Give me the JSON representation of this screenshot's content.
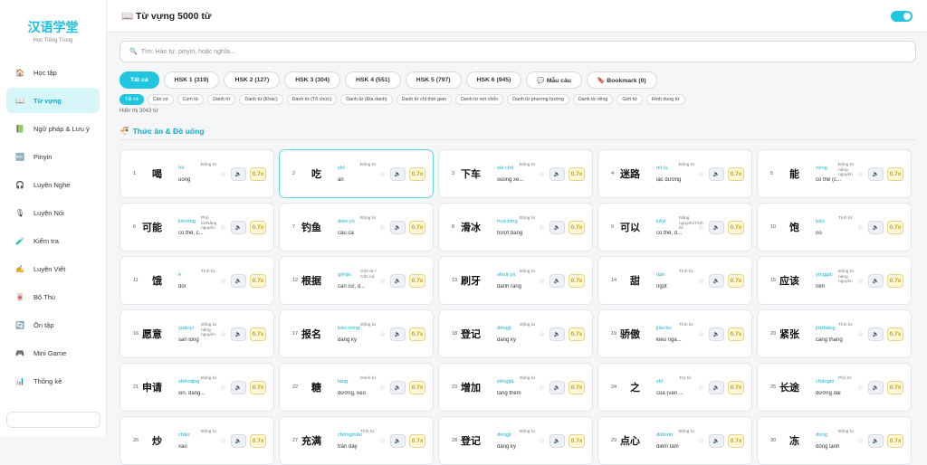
{
  "logo": {
    "title": "汉语学堂",
    "subtitle": "Học Tiếng Trung"
  },
  "nav": [
    {
      "icon": "🏠",
      "label": "Học tập"
    },
    {
      "icon": "📖",
      "label": "Từ vựng",
      "active": true
    },
    {
      "icon": "📗",
      "label": "Ngữ pháp & Lưu ý"
    },
    {
      "icon": "🔤",
      "label": "Pinyin"
    },
    {
      "icon": "🎧",
      "label": "Luyện Nghe"
    },
    {
      "icon": "🎙",
      "label": "Luyện Nói"
    },
    {
      "icon": "🧪",
      "label": "Kiểm tra"
    },
    {
      "icon": "✍",
      "label": "Luyện Viết"
    },
    {
      "icon": "🀄",
      "label": "Bộ Thủ"
    },
    {
      "icon": "🔄",
      "label": "Ôn tập"
    },
    {
      "icon": "🎮",
      "label": "Mini Game"
    },
    {
      "icon": "📊",
      "label": "Thống kê"
    }
  ],
  "header": {
    "icon": "📖",
    "title": "Từ vựng 5000 từ"
  },
  "search": {
    "icon": "🔍",
    "placeholder": "Tìm: Hán tự, pinyin, hoặc nghĩa..."
  },
  "hsk_filters": [
    {
      "label": "Tất cả",
      "active": true
    },
    {
      "label": "HSK 1 (319)"
    },
    {
      "label": "HSK 2 (127)"
    },
    {
      "label": "HSK 3 (304)"
    },
    {
      "label": "HSK 4 (551)"
    },
    {
      "label": "HSK 5 (797)"
    },
    {
      "label": "HSK 6 (945)"
    },
    {
      "label": "💬 Mẫu câu"
    },
    {
      "label": "🔖 Bookmark (0)"
    }
  ],
  "type_filters": [
    {
      "label": "Tất cả",
      "active": true
    },
    {
      "label": "Cần có"
    },
    {
      "label": "Cụm từ"
    },
    {
      "label": "Danh từ"
    },
    {
      "label": "Danh từ (Khác)"
    },
    {
      "label": "Danh từ (Tổ chức)"
    },
    {
      "label": "Danh từ (Địa danh)"
    },
    {
      "label": "Danh từ chỉ thời gian"
    },
    {
      "label": "Danh từ nơi chốn"
    },
    {
      "label": "Danh từ phương hướng"
    },
    {
      "label": "Danh từ riêng"
    },
    {
      "label": "Giới từ"
    },
    {
      "label": "Hình dung từ"
    }
  ],
  "count_text": "Hiển thị 3043 từ",
  "section": {
    "icon": "🍜",
    "title": "Thức ăn & Đồ uống"
  },
  "speaker_icon": "🔈",
  "speed_label": "0.7x",
  "star_icon": "☆",
  "words": [
    {
      "n": "1",
      "hz": "喝",
      "py": "hē",
      "pos": "Động từ",
      "mean": "uống"
    },
    {
      "n": "2",
      "hz": "吃",
      "py": "chī",
      "pos": "Động từ",
      "mean": "ăn",
      "highlight": true
    },
    {
      "n": "3",
      "hz": "下车",
      "py": "xià chē",
      "pos": "Động từ",
      "mean": "xuống xe..."
    },
    {
      "n": "4",
      "hz": "迷路",
      "py": "mí lù",
      "pos": "Động từ",
      "mean": "lạc đường"
    },
    {
      "n": "5",
      "hz": "能",
      "py": "néng",
      "pos": "Động từ năng nguyện",
      "mean": "có thể (c..."
    },
    {
      "n": "6",
      "hz": "可能",
      "py": "kěnéng",
      "pos": "Phó từ/Năng nguyện",
      "mean": "có thể, c..."
    },
    {
      "n": "7",
      "hz": "钓鱼",
      "py": "diào yú",
      "pos": "Động từ",
      "mean": "câu cá"
    },
    {
      "n": "8",
      "hz": "滑冰",
      "py": "huá bīng",
      "pos": "Động từ",
      "mean": "trượt băng"
    },
    {
      "n": "9",
      "hz": "可以",
      "py": "kěyǐ",
      "pos": "Năng nguyện/Tính từ",
      "mean": "có thể, đ..."
    },
    {
      "n": "10",
      "hz": "饱",
      "py": "bǎo",
      "pos": "Tính từ",
      "mean": "no"
    },
    {
      "n": "11",
      "hz": "饿",
      "py": "è",
      "pos": "Tính từ",
      "mean": "đói"
    },
    {
      "n": "12",
      "hz": "根据",
      "py": "gēnjù",
      "pos": "Giới từ / Căn cứ",
      "mean": "căn cứ, d..."
    },
    {
      "n": "13",
      "hz": "刷牙",
      "py": "shuā yá",
      "pos": "Động từ",
      "mean": "đánh răng"
    },
    {
      "n": "14",
      "hz": "甜",
      "py": "tián",
      "pos": "Tính từ",
      "mean": "ngọt"
    },
    {
      "n": "15",
      "hz": "应该",
      "py": "yīnggāi",
      "pos": "Động từ năng nguyện",
      "mean": "nên"
    },
    {
      "n": "16",
      "hz": "愿意",
      "py": "yuànyì",
      "pos": "Động từ năng nguyện",
      "mean": "sẵn lòng"
    },
    {
      "n": "17",
      "hz": "报名",
      "py": "bào míng",
      "pos": "Động từ",
      "mean": "đăng ký"
    },
    {
      "n": "18",
      "hz": "登记",
      "py": "dēngjì",
      "pos": "Động từ",
      "mean": "đăng ký"
    },
    {
      "n": "19",
      "hz": "骄傲",
      "py": "jiāo'ào",
      "pos": "Tính từ",
      "mean": "kiêu ngạ..."
    },
    {
      "n": "20",
      "hz": "紧张",
      "py": "jǐnzhāng",
      "pos": "Tính từ",
      "mean": "căng thẳng"
    },
    {
      "n": "21",
      "hz": "申请",
      "py": "shēnqǐng",
      "pos": "Động từ",
      "mean": "xin, đăng..."
    },
    {
      "n": "22",
      "hz": "糖",
      "py": "táng",
      "pos": "Danh từ",
      "mean": "đường, kẹo"
    },
    {
      "n": "23",
      "hz": "增加",
      "py": "zēngjiā",
      "pos": "Động từ",
      "mean": "tăng thêm"
    },
    {
      "n": "24",
      "hz": "之",
      "py": "zhī",
      "pos": "Trợ từ",
      "mean": "của (văn ..."
    },
    {
      "n": "25",
      "hz": "长途",
      "py": "chángtú",
      "pos": "Phó từ",
      "mean": "đường dài"
    },
    {
      "n": "26",
      "hz": "炒",
      "py": "chǎo",
      "pos": "Động từ",
      "mean": "xào"
    },
    {
      "n": "27",
      "hz": "充满",
      "py": "chōngmǎn",
      "pos": "Tính từ",
      "mean": "tràn đầy"
    },
    {
      "n": "28",
      "hz": "登记",
      "py": "dēngjì",
      "pos": "Động từ",
      "mean": "đăng ký"
    },
    {
      "n": "29",
      "hz": "点心",
      "py": "diǎnxin",
      "pos": "Động từ",
      "mean": "điểm tâm"
    },
    {
      "n": "30",
      "hz": "冻",
      "py": "dòng",
      "pos": "Động từ",
      "mean": "đông lạnh"
    }
  ]
}
